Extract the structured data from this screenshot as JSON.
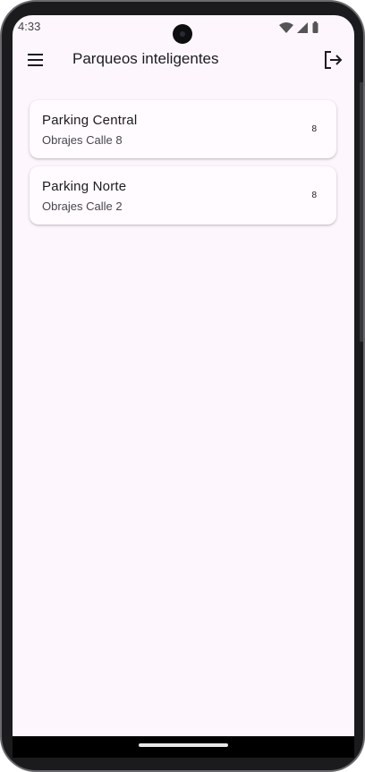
{
  "status_bar": {
    "time": "4:33",
    "icons": [
      "wifi-icon",
      "cellular-signal-icon",
      "battery-icon"
    ]
  },
  "app_bar": {
    "title": "Parqueos inteligentes",
    "menu_icon": "menu-icon",
    "logout_icon": "logout-icon"
  },
  "parkings": [
    {
      "name": "Parking Central",
      "address": "Obrajes Calle 8",
      "count": "8"
    },
    {
      "name": "Parking Norte",
      "address": "Obrajes Calle 2",
      "count": "8"
    }
  ],
  "colors": {
    "background": "#fdf7fd",
    "card": "#fffbfe",
    "text_primary": "#1d1b20",
    "text_secondary": "#49454f"
  }
}
